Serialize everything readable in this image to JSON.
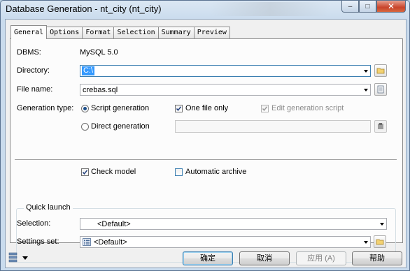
{
  "window": {
    "title": "Database Generation - nt_city (nt_city)",
    "controls": {
      "minimize": "–",
      "maximize": "□",
      "close": "✕"
    }
  },
  "tabs": [
    {
      "label": "General",
      "active": true
    },
    {
      "label": "Options"
    },
    {
      "label": "Format"
    },
    {
      "label": "Selection"
    },
    {
      "label": "Summary"
    },
    {
      "label": "Preview"
    }
  ],
  "general": {
    "dbms_label": "DBMS:",
    "dbms_value": "MySQL 5.0",
    "directory_label": "Directory:",
    "directory_value": "C:\\",
    "filename_label": "File name:",
    "filename_value": "crebas.sql",
    "generation_type_label": "Generation type:",
    "script_generation": "Script generation",
    "direct_generation": "Direct generation",
    "one_file_only": "One file only",
    "edit_generation_script": "Edit generation script",
    "check_model": "Check model",
    "automatic_archive": "Automatic archive",
    "quick_launch_title": "Quick launch",
    "selection_label": "Selection:",
    "selection_value": "<Default>",
    "settings_set_label": "Settings set:",
    "settings_set_value": "<Default>"
  },
  "state": {
    "generation_type": "script",
    "one_file_only_checked": true,
    "edit_generation_script_checked": true,
    "edit_generation_script_enabled": false,
    "check_model_checked": true,
    "automatic_archive_checked": false
  },
  "buttons": {
    "ok": "确定",
    "cancel": "取消",
    "apply": "应用 (A)",
    "help": "帮助"
  },
  "icons": {
    "browse_directory": "folder-icon",
    "edit_file": "document-icon",
    "direct_connect": "database-connect-icon",
    "settings_set": "list-icon",
    "settings_folder": "folder-icon",
    "bottom_left_menu": "settings-menu-icon"
  }
}
